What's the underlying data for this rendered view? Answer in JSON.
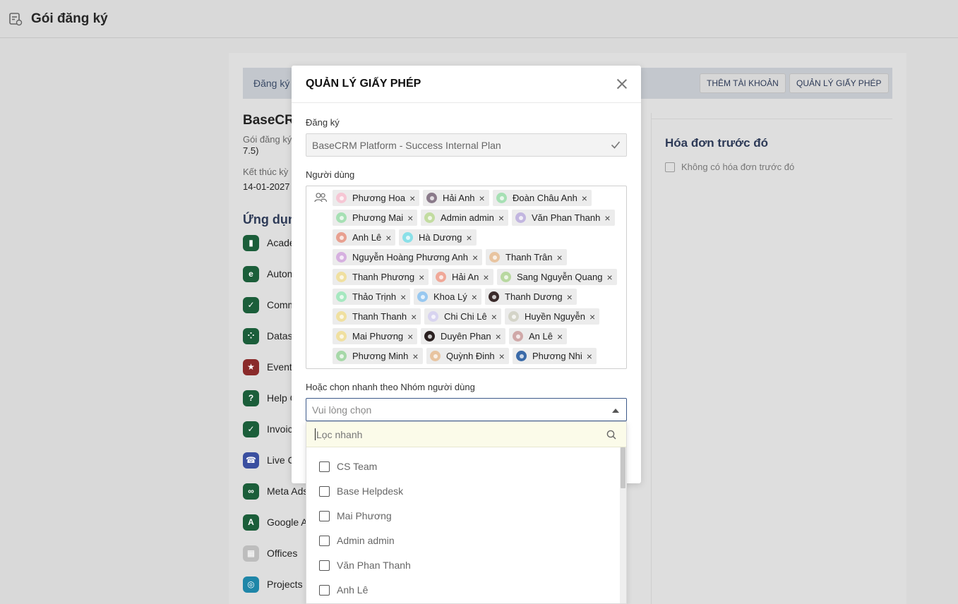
{
  "page": {
    "title": "Gói đăng ký"
  },
  "background": {
    "bar_label": "Đăng ký",
    "buttons": {
      "add_account": "THÊM TÀI KHOẢN",
      "manage_license": "QUẢN LÝ GIẤY PHÉP"
    },
    "product_name": "BaseCR",
    "plan_line1": "Gói đăng ký",
    "plan_line2": "7.5)",
    "period_label": "Kết thúc kỳ",
    "period_value": "14-01-2027",
    "apps_heading": "Ứng dụng",
    "apps": [
      {
        "label": "Acade",
        "icon": "academy-icon",
        "color": "#1b5e3a"
      },
      {
        "label": "Autom",
        "icon": "automation-icon",
        "color": "#1b5e3a"
      },
      {
        "label": "Comm",
        "icon": "community-icon",
        "color": "#1b5e3a"
      },
      {
        "label": "Datas",
        "icon": "datasheet-icon",
        "color": "#1b5e3a"
      },
      {
        "label": "Event",
        "icon": "event-icon",
        "color": "#8a2a2a"
      },
      {
        "label": "Help C",
        "icon": "help-center-icon",
        "color": "#1b5e3a"
      },
      {
        "label": "Invoic",
        "icon": "invoice-icon",
        "color": "#1b5e3a"
      },
      {
        "label": "Live C",
        "icon": "live-chat-icon",
        "color": "#3a4fa0"
      },
      {
        "label": "Meta Ads",
        "icon": "meta-ads-icon",
        "color": "#1b5e3a"
      },
      {
        "label": "Google A",
        "icon": "google-ads-icon",
        "color": "#1b5e3a"
      },
      {
        "label": "Offices",
        "icon": "offices-icon",
        "color": "#bdbdbd"
      },
      {
        "label": "Projects",
        "icon": "projects-icon",
        "color": "#1f86a8"
      }
    ],
    "invoice_heading": "Hóa đơn trước đó",
    "invoice_empty": "Không có hóa đơn trước đó"
  },
  "modal": {
    "title": "QUẢN LÝ GIẤY PHÉP",
    "plan_label": "Đăng ký",
    "plan_value": "BaseCRM Platform - Success Internal Plan",
    "users_label": "Người dùng",
    "users": [
      {
        "name": "Phương Hoa",
        "color": "#f6c6d4"
      },
      {
        "name": "Hải Anh",
        "color": "#8a7a8a"
      },
      {
        "name": "Đoàn Châu Anh",
        "color": "#a6e0b4"
      },
      {
        "name": "Phương Mai",
        "color": "#a6e0b4"
      },
      {
        "name": "Admin admin",
        "color": "#c2dca0"
      },
      {
        "name": "Văn Phan Thanh",
        "color": "#c2b6e0"
      },
      {
        "name": "Anh Lê",
        "color": "#e8a090"
      },
      {
        "name": "Hà Dương",
        "color": "#8ae0e8"
      },
      {
        "name": "Nguyễn Hoàng Phương Anh",
        "color": "#d6b0e0"
      },
      {
        "name": "Thanh Trân",
        "color": "#e8c4a0"
      },
      {
        "name": "Thanh Phương",
        "color": "#f0e0a0"
      },
      {
        "name": "Hải An",
        "color": "#f0a898"
      },
      {
        "name": "Sang Nguyễn Quang",
        "color": "#b8d8a0"
      },
      {
        "name": "Thảo Trịnh",
        "color": "#a6e8c0"
      },
      {
        "name": "Khoa Lý",
        "color": "#98c8f0"
      },
      {
        "name": "Thanh Dương",
        "color": "#3a2a2a"
      },
      {
        "name": "Thanh Thanh",
        "color": "#f0e0a0"
      },
      {
        "name": "Chi Chi Lê",
        "color": "#d8d4f0"
      },
      {
        "name": "Huyền Nguyễn",
        "color": "#d4d4c8"
      },
      {
        "name": "Mai Phương",
        "color": "#f0e0a0"
      },
      {
        "name": "Duyên Phan",
        "color": "#2a2020"
      },
      {
        "name": "An Lê",
        "color": "#d0a8a8"
      },
      {
        "name": "Phương Minh",
        "color": "#a6d8a8"
      },
      {
        "name": "Quỳnh Đinh",
        "color": "#e8c4a0"
      },
      {
        "name": "Phương Nhi",
        "color": "#3a6aa8"
      }
    ],
    "group_label": "Hoặc chọn nhanh theo Nhóm người dùng",
    "group_placeholder": "Vui lòng chọn"
  },
  "dropdown": {
    "filter_placeholder": "Lọc nhanh",
    "options": [
      "CS Team",
      "Base Helpdesk",
      "Mai Phương",
      "Admin admin",
      "Văn Phan Thanh",
      "Anh Lê"
    ]
  }
}
